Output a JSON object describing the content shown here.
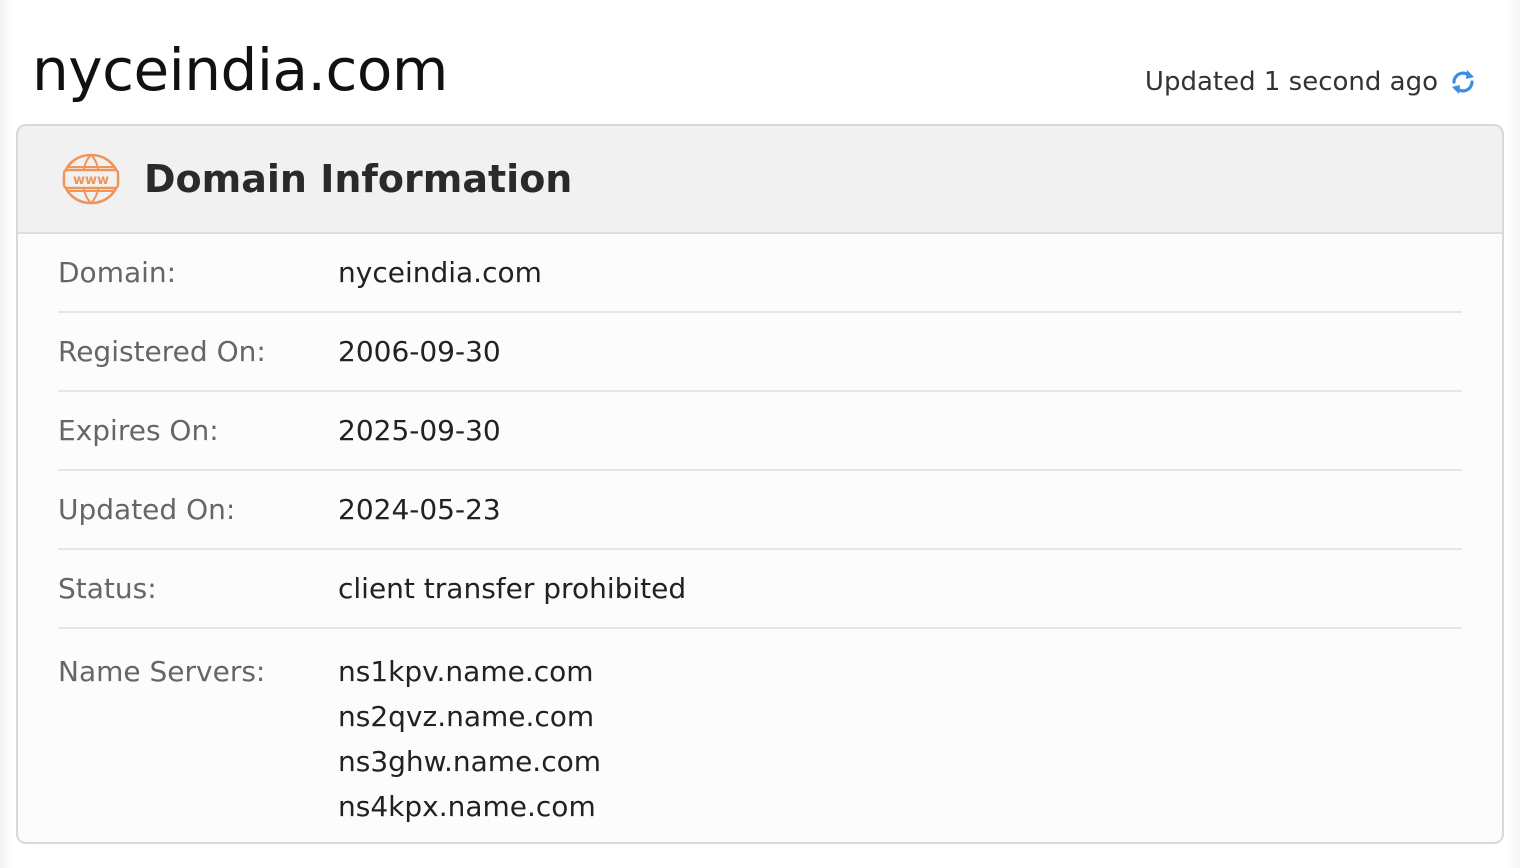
{
  "page": {
    "title": "nyceindia.com",
    "updated_text": "Updated 1 second ago",
    "refresh_icon": "refresh-icon"
  },
  "card": {
    "header_icon": "www-icon",
    "header_icon_text": "www",
    "title": "Domain Information",
    "accent_color": "#f0945a",
    "refresh_color": "#3d8fe0"
  },
  "fields": {
    "domain": {
      "label": "Domain:",
      "value": "nyceindia.com"
    },
    "registered": {
      "label": "Registered On:",
      "value": "2006-09-30"
    },
    "expires": {
      "label": "Expires On:",
      "value": "2025-09-30"
    },
    "updated": {
      "label": "Updated On:",
      "value": "2024-05-23"
    },
    "status": {
      "label": "Status:",
      "value": "client transfer prohibited"
    },
    "name_servers": {
      "label": "Name Servers:",
      "values": [
        "ns1kpv.name.com",
        "ns2qvz.name.com",
        "ns3ghw.name.com",
        "ns4kpx.name.com"
      ]
    }
  }
}
